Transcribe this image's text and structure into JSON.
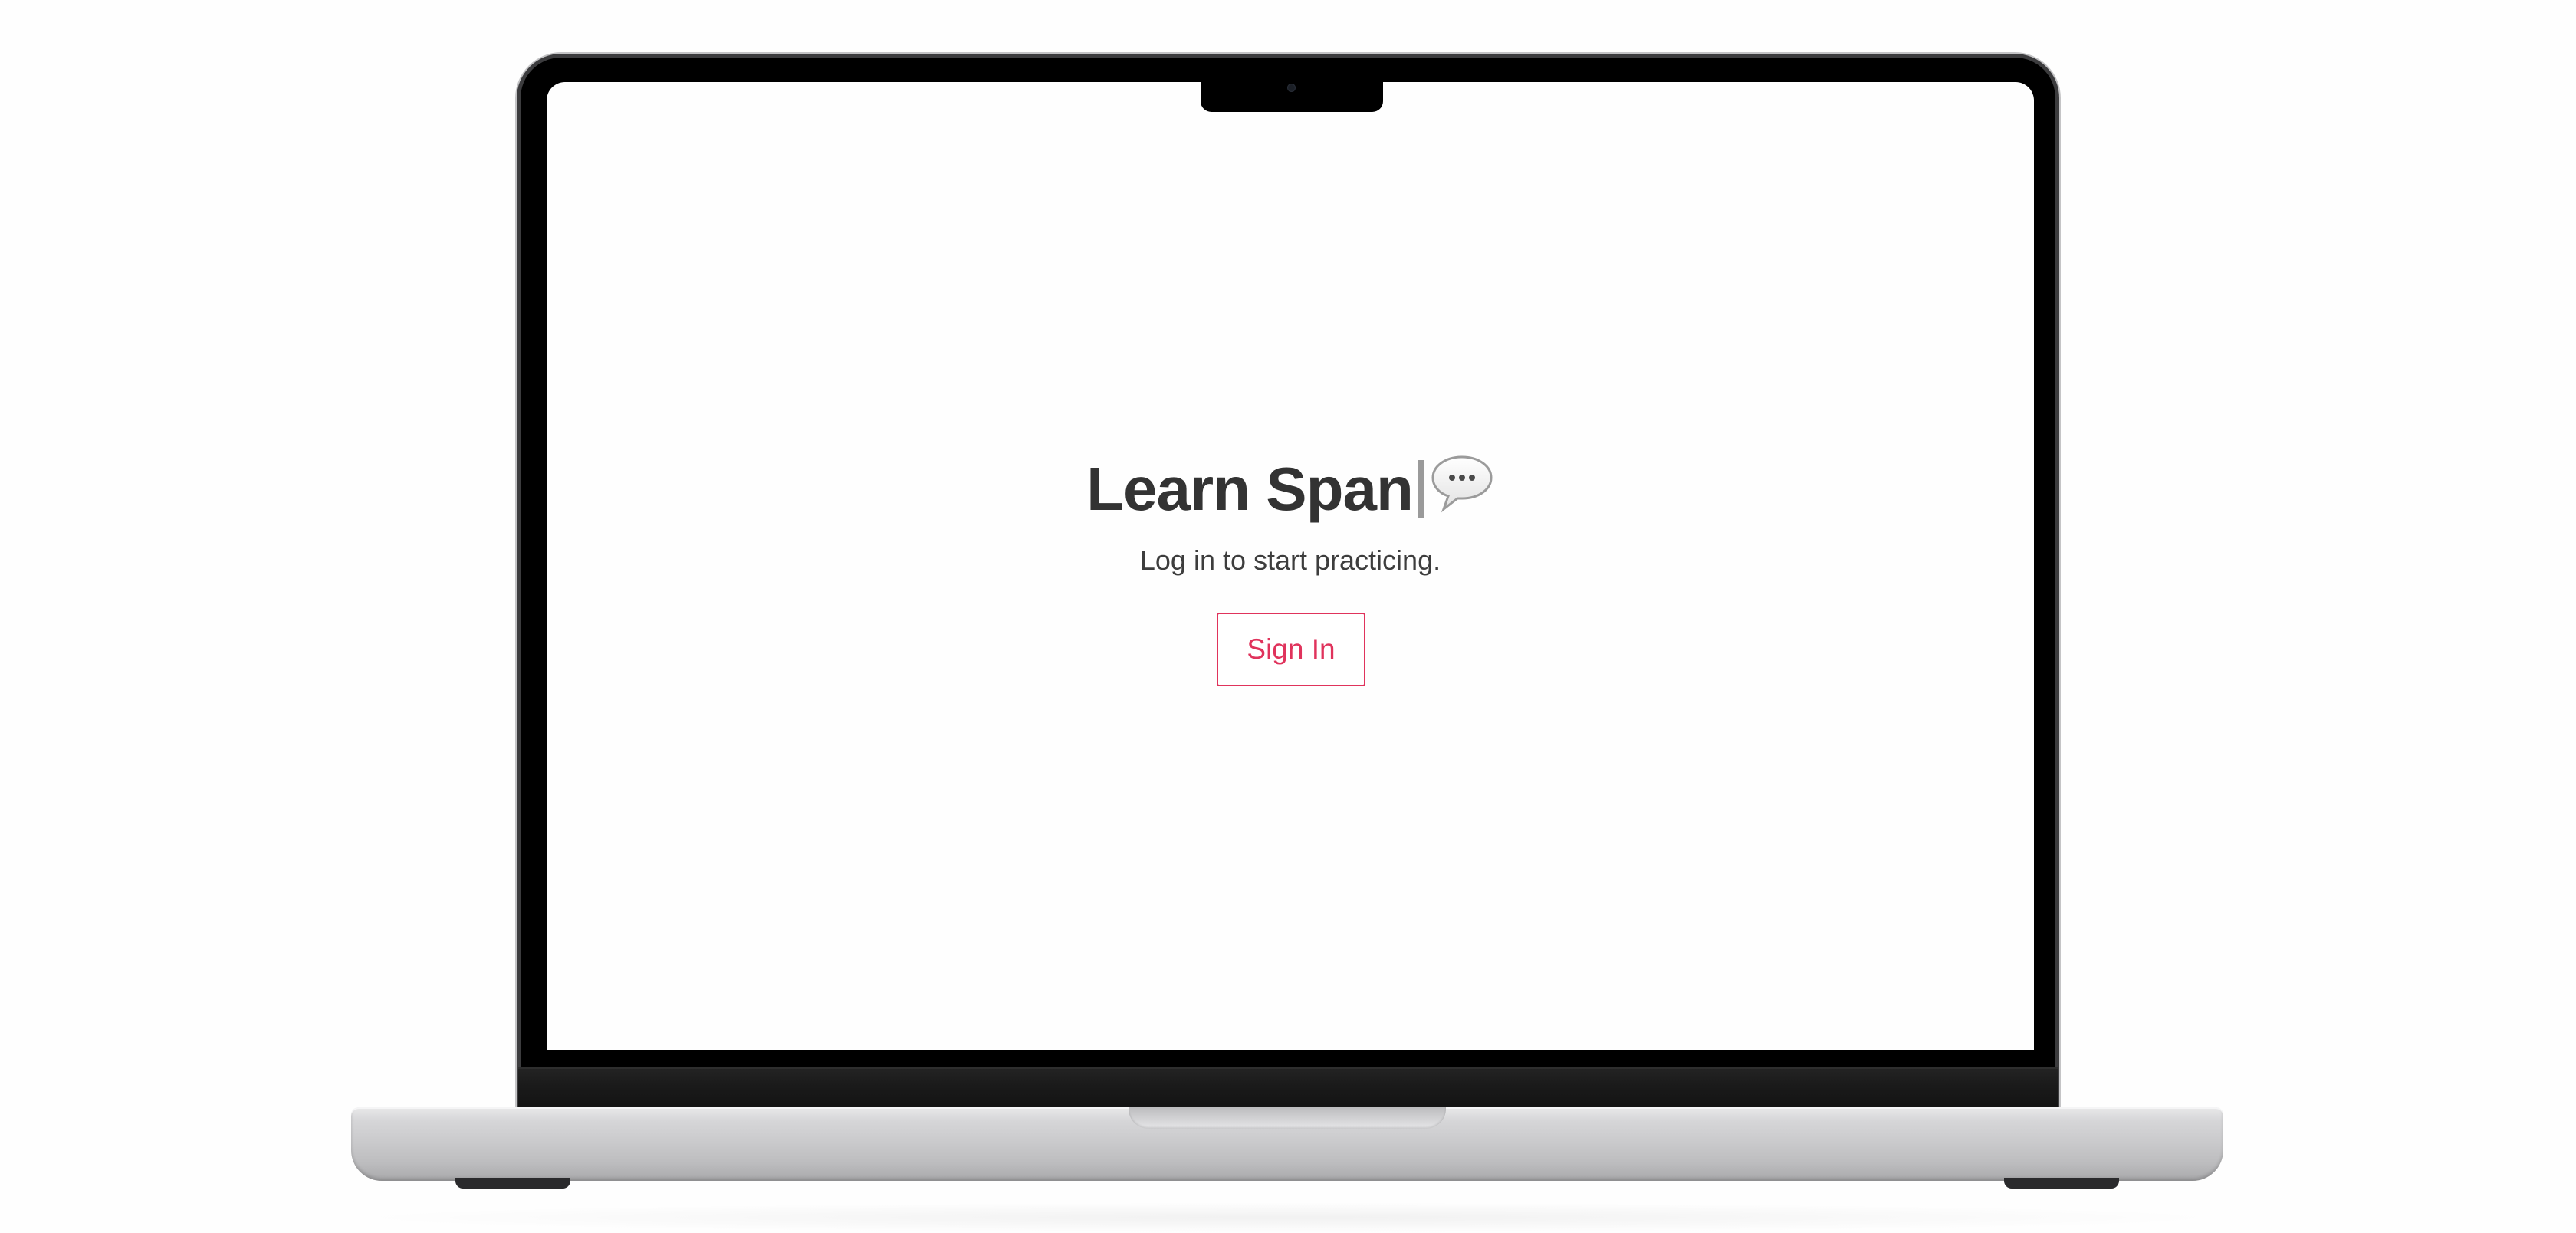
{
  "app": {
    "title": "Learn Span",
    "title_icon": "speech-bubble-ellipsis-icon",
    "subtitle": "Log in to start practicing.",
    "signin_label": "Sign In"
  },
  "colors": {
    "accent": "#e0335c",
    "title_text": "#333333",
    "subtitle_text": "#3d3d3d",
    "screen_background": "#fefefe",
    "bezel": "#000000",
    "laptop_body": "#cbcbcd"
  },
  "device": {
    "frame": "laptop",
    "camera_icon": "camera-icon"
  }
}
